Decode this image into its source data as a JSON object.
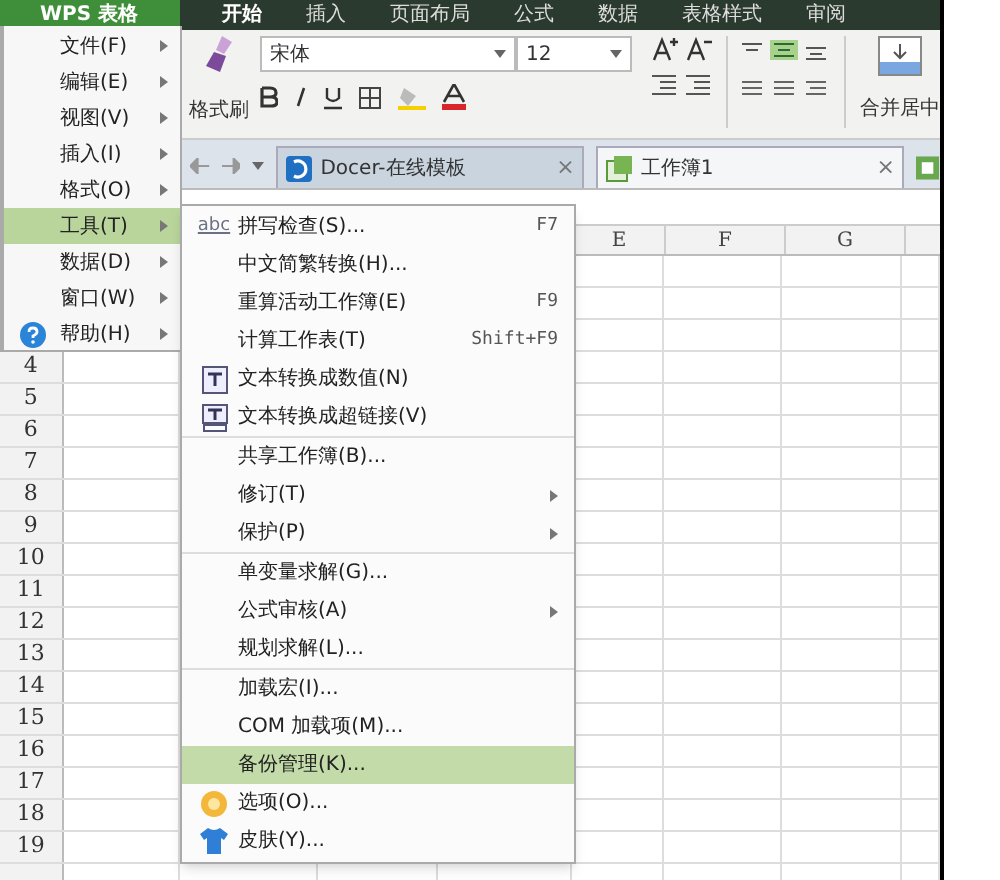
{
  "app_button": "WPS 表格",
  "ribbon_tabs": [
    {
      "label": "开始",
      "selected": true
    },
    {
      "label": "插入",
      "selected": false
    },
    {
      "label": "页面布局",
      "selected": false
    },
    {
      "label": "公式",
      "selected": false
    },
    {
      "label": "数据",
      "selected": false
    },
    {
      "label": "表格样式",
      "selected": false
    },
    {
      "label": "审阅",
      "selected": false
    }
  ],
  "ribbon": {
    "format_painter": "格式刷",
    "font": "宋体",
    "font_size": "12",
    "merge": "合并居中"
  },
  "doc_tabs": [
    {
      "label": "Docer-在线模板",
      "selected": false,
      "close": "×"
    },
    {
      "label": "工作簿1",
      "selected": true,
      "close": "×"
    }
  ],
  "columns": [
    "E",
    "F",
    "G"
  ],
  "rows": [
    "4",
    "5",
    "6",
    "7",
    "8",
    "9",
    "10",
    "11",
    "12",
    "13",
    "14",
    "15",
    "16",
    "17",
    "18",
    "19"
  ],
  "main_menu": [
    {
      "label": "文件(F)",
      "selected": false,
      "kind": "plain"
    },
    {
      "label": "编辑(E)",
      "selected": false,
      "kind": "plain"
    },
    {
      "label": "视图(V)",
      "selected": false,
      "kind": "plain"
    },
    {
      "label": "插入(I)",
      "selected": false,
      "kind": "plain"
    },
    {
      "label": "格式(O)",
      "selected": false,
      "kind": "plain"
    },
    {
      "label": "工具(T)",
      "selected": true,
      "kind": "plain"
    },
    {
      "label": "数据(D)",
      "selected": false,
      "kind": "plain"
    },
    {
      "label": "窗口(W)",
      "selected": false,
      "kind": "plain"
    },
    {
      "label": "帮助(H)",
      "selected": false,
      "kind": "help"
    }
  ],
  "submenu": [
    [
      {
        "label": "拼写检查(S)...",
        "shortcut": "F7",
        "kind": "spell",
        "icon_text": "abc",
        "submenu": false,
        "selected": false
      },
      {
        "label": "中文简繁转换(H)...",
        "kind": "plain",
        "submenu": false,
        "selected": false
      },
      {
        "label": "重算活动工作簿(E)",
        "shortcut": "F9",
        "kind": "plain",
        "submenu": false,
        "selected": false
      },
      {
        "label": "计算工作表(T)",
        "shortcut": "Shift+F9",
        "kind": "plain",
        "submenu": false,
        "selected": false
      },
      {
        "label": "文本转换成数值(N)",
        "kind": "number",
        "submenu": false,
        "selected": false
      },
      {
        "label": "文本转换成超链接(V)",
        "kind": "link",
        "submenu": false,
        "selected": false
      }
    ],
    [
      {
        "label": "共享工作簿(B)...",
        "kind": "plain",
        "submenu": false,
        "selected": false
      },
      {
        "label": "修订(T)",
        "kind": "plain",
        "submenu": true,
        "selected": false
      },
      {
        "label": "保护(P)",
        "kind": "plain",
        "submenu": true,
        "selected": false
      }
    ],
    [
      {
        "label": "单变量求解(G)...",
        "kind": "plain",
        "submenu": false,
        "selected": false
      },
      {
        "label": "公式审核(A)",
        "kind": "plain",
        "submenu": true,
        "selected": false
      },
      {
        "label": "规划求解(L)...",
        "kind": "plain",
        "submenu": false,
        "selected": false
      }
    ],
    [
      {
        "label": "加载宏(I)...",
        "kind": "plain",
        "submenu": false,
        "selected": false
      },
      {
        "label": "COM 加载项(M)...",
        "kind": "plain",
        "submenu": false,
        "selected": false
      },
      {
        "label": "备份管理(K)...",
        "kind": "plain",
        "submenu": false,
        "selected": true
      },
      {
        "label": "选项(O)...",
        "kind": "gear",
        "submenu": false,
        "selected": false
      },
      {
        "label": "皮肤(Y)...",
        "kind": "shirt",
        "submenu": false,
        "selected": false
      }
    ]
  ]
}
